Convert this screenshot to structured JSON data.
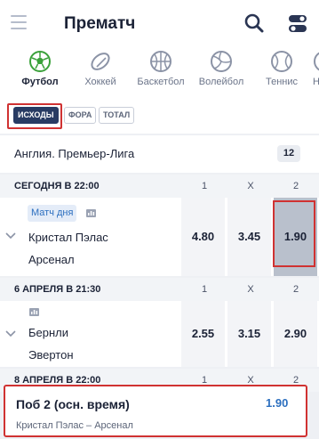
{
  "header": {
    "title": "Прематч",
    "menu_icon": "menu-icon",
    "search_icon": "search-icon",
    "settings_icon": "toggle-icon"
  },
  "sports": [
    {
      "label": "Футбол",
      "icon": "soccer-ball-icon",
      "active": true
    },
    {
      "label": "Хоккей",
      "icon": "hockey-puck-icon"
    },
    {
      "label": "Баскетбол",
      "icon": "basketball-icon"
    },
    {
      "label": "Волейбол",
      "icon": "volleyball-icon"
    },
    {
      "label": "Теннис",
      "icon": "tennis-ball-icon"
    },
    {
      "label": "Н",
      "icon": "more-sport-icon"
    }
  ],
  "filters": [
    {
      "label": "ИСХОДЫ",
      "active": true
    },
    {
      "label": "ФОРА"
    },
    {
      "label": "ТОТАЛ"
    }
  ],
  "league": {
    "name": "Англия. Премьер-Лига",
    "count": "12"
  },
  "columns": [
    "1",
    "X",
    "2"
  ],
  "matches": [
    {
      "date": "СЕГОДНЯ В 22:00",
      "badge": "Матч дня",
      "home": "Кристал Пэлас",
      "away": "Арсенал",
      "odds": [
        "4.80",
        "3.45",
        "1.90"
      ],
      "selected_index": 2
    },
    {
      "date": "6 АПРЕЛЯ В 21:30",
      "home": "Бернли",
      "away": "Эвертон",
      "odds": [
        "2.55",
        "3.15",
        "2.90"
      ]
    },
    {
      "date": "8 АПРЕЛЯ В 22:00"
    }
  ],
  "bet_slip": {
    "title": "Поб 2 (осн. время)",
    "odd": "1.90",
    "event": "Кристал Пэлас – Арсенал"
  },
  "colors": {
    "accent": "#2c6fbf",
    "highlight_frame": "#d03232",
    "chip_active": "#283b63",
    "selected_odd": "#b9c0cc"
  }
}
